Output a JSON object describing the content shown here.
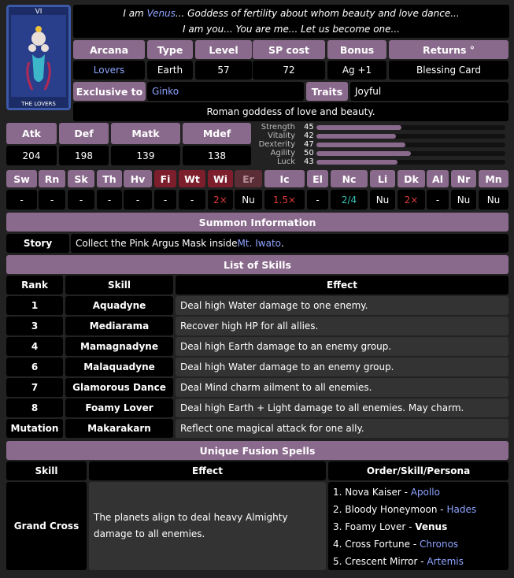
{
  "card": {
    "numeral": "VI",
    "caption": "THE LOVERS"
  },
  "intro": {
    "line1_pre": "I am ",
    "line1_name": "Venus",
    "line1_post": "... Goddess of fertility about whom beauty and love dance...",
    "line2": "I am you... You are me... Let us become one..."
  },
  "info_headers": [
    "Arcana",
    "Type",
    "Level",
    "SP cost",
    "Bonus",
    "Returns °"
  ],
  "info_values": [
    "Lovers",
    "Earth",
    "57",
    "72",
    "Ag +1",
    "Blessing Card"
  ],
  "exclusive_label": "Exclusive to",
  "exclusive_value": "Ginko",
  "traits_label": "Traits",
  "traits_value": "Joyful",
  "description": "Roman goddess of love and beauty.",
  "stat_headers": [
    "Atk",
    "Def",
    "Matk",
    "Mdef"
  ],
  "stat_values": [
    "204",
    "198",
    "139",
    "138"
  ],
  "attributes": [
    {
      "name": "Strength",
      "value": 45
    },
    {
      "name": "Vitality",
      "value": 42
    },
    {
      "name": "Dexterity",
      "value": 47
    },
    {
      "name": "Agility",
      "value": 50
    },
    {
      "name": "Luck",
      "value": 43
    }
  ],
  "elements": [
    "Sw",
    "Rn",
    "Sk",
    "Th",
    "Hv",
    "Fi",
    "Wt",
    "Wi",
    "Er",
    "Ic",
    "El",
    "Nc",
    "Li",
    "Dk",
    "Al",
    "Nr",
    "Mn"
  ],
  "resists": [
    "-",
    "-",
    "-",
    "-",
    "-",
    "-",
    "-",
    "2×",
    "Nu",
    "1.5×",
    "-",
    "2/4",
    "Nu",
    "2×",
    "-",
    "Nu",
    "Nu"
  ],
  "summon_title": "Summon Information",
  "story_label": "Story",
  "story_pre": "Collect the Pink Argus Mask inside ",
  "story_link": "Mt. Iwato",
  "story_post": ".",
  "skills_title": "List of Skills",
  "skills_headers": [
    "Rank",
    "Skill",
    "Effect"
  ],
  "skills": [
    {
      "rank": "1",
      "skill": "Aquadyne",
      "effect": "Deal high Water damage to one enemy."
    },
    {
      "rank": "3",
      "skill": "Mediarama",
      "effect": "Recover high HP for all allies."
    },
    {
      "rank": "4",
      "skill": "Mamagnadyne",
      "effect": "Deal high Earth damage to an enemy group."
    },
    {
      "rank": "6",
      "skill": "Malaquadyne",
      "effect": "Deal high Water damage to an enemy group."
    },
    {
      "rank": "7",
      "skill": "Glamorous Dance",
      "effect": "Deal Mind charm ailment to all enemies."
    },
    {
      "rank": "8",
      "skill": "Foamy Lover",
      "effect": "Deal high Earth + Light damage to all enemies. May charm."
    },
    {
      "rank": "Mutation",
      "skill": "Makarakarn",
      "effect": "Reflect one magical attack for one ally."
    }
  ],
  "fusion_title": "Unique Fusion Spells",
  "fusion_headers": [
    "Skill",
    "Effect",
    "Order/Skill/Persona"
  ],
  "fusion_skill": "Grand Cross",
  "fusion_effect": "The planets align to deal heavy Almighty damage to all enemies.",
  "fusion_order": [
    {
      "text": "1. Nova Kaiser - ",
      "persona": "Apollo",
      "bold": false
    },
    {
      "text": "2. Bloody Honeymoon - ",
      "persona": "Hades",
      "bold": false
    },
    {
      "text": "3. Foamy Lover - ",
      "persona": "Venus",
      "bold": true
    },
    {
      "text": "4. Cross Fortune - ",
      "persona": "Chronos",
      "bold": false
    },
    {
      "text": "5. Crescent Mirror - ",
      "persona": "Artemis",
      "bold": false
    }
  ]
}
